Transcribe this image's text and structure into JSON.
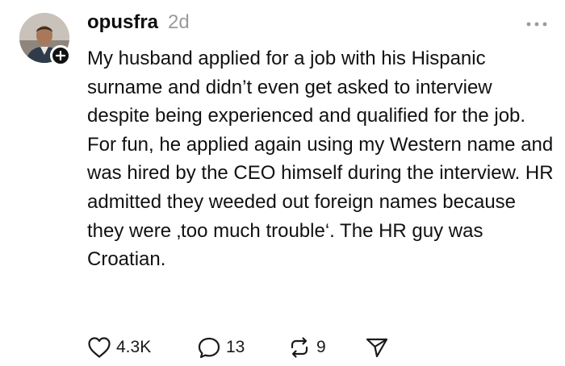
{
  "post": {
    "author": {
      "username": "opusfra",
      "timestamp": "2d",
      "avatar_icon": "profile-photo",
      "follow_icon": "plus-icon"
    },
    "more_icon": "more-dots-icon",
    "body": "My husband applied for a job with his Hispanic surname and didn’t even get asked to interview despite being experienced and qualified for the job. For fun, he applied again using my Western name and was hired by the CEO himself during the interview. HR admitted they weeded out foreign names because they were ‚too much trouble‘. The HR guy was Croatian.",
    "actions": {
      "likes": "4.3K",
      "replies": "13",
      "reposts": "9",
      "like_icon": "heart-icon",
      "reply_icon": "comment-bubble-icon",
      "repost_icon": "repost-icon",
      "share_icon": "send-icon"
    }
  },
  "colors": {
    "text": "#111111",
    "muted": "#9a9a9a",
    "background": "#ffffff"
  }
}
